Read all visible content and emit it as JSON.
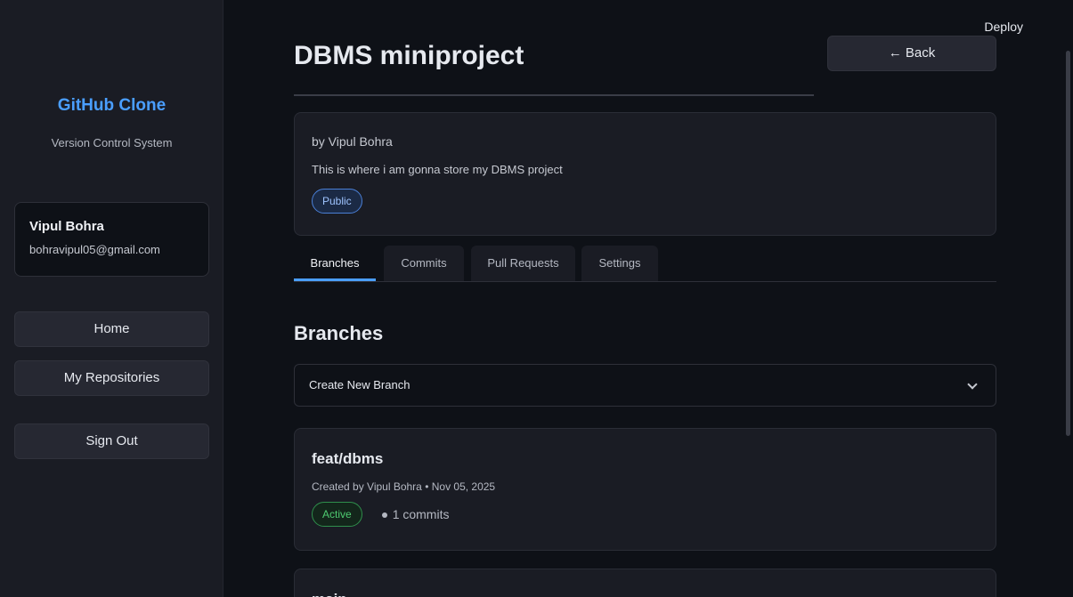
{
  "sidebar": {
    "brand_title": "GitHub Clone",
    "brand_subtitle": "Version Control System",
    "user": {
      "name": "Vipul Bohra",
      "email": "bohravipul05@gmail.com"
    },
    "nav": {
      "home": "Home",
      "my_repositories": "My Repositories",
      "sign_out": "Sign Out"
    }
  },
  "header": {
    "deploy_label": "Deploy",
    "title": "DBMS miniproject",
    "back_label": "← Back"
  },
  "repo": {
    "owner_line": "by Vipul Bohra",
    "description": "This is where i am gonna store my DBMS project",
    "visibility": "Public"
  },
  "tabs": [
    {
      "label": "Branches"
    },
    {
      "label": "Commits"
    },
    {
      "label": "Pull Requests"
    },
    {
      "label": "Settings"
    }
  ],
  "branches_section": {
    "title": "Branches",
    "create_label": "Create New Branch",
    "items": [
      {
        "name": "feat/dbms",
        "meta": "Created by Vipul Bohra • Nov 05, 2025",
        "status": "Active",
        "commits": "1 commits"
      },
      {
        "name": "main"
      }
    ]
  },
  "colors": {
    "accent": "#4a9eff",
    "active_green": "#4ecb71",
    "background": "#0e1117",
    "sidebar": "#1a1c24"
  },
  "icons": {
    "dropdown": "chevron-down-icon",
    "dot": "dot-icon"
  }
}
